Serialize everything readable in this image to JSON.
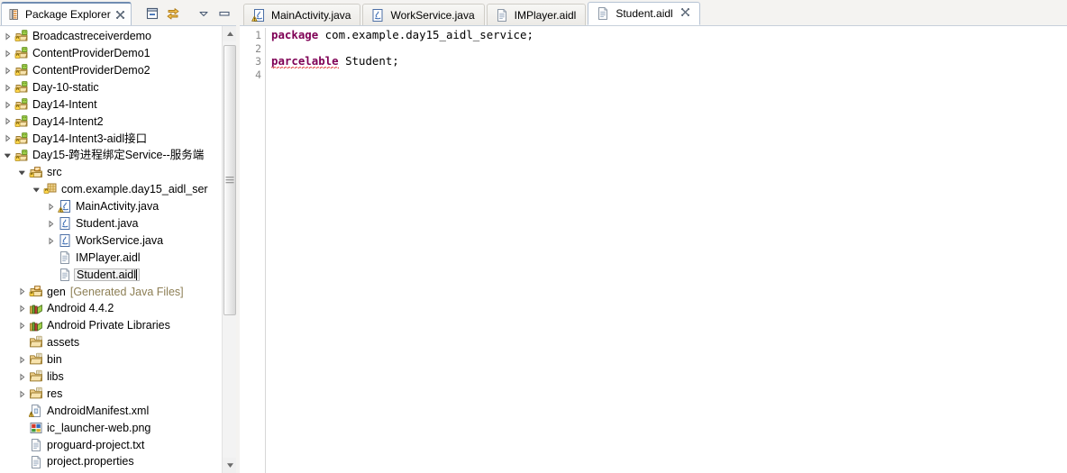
{
  "explorer": {
    "tab": {
      "title": "Package Explorer",
      "icon": "package-explorer-icon",
      "close_icon": "close-icon"
    },
    "toolbar": [
      {
        "name": "collapse-all-button",
        "icon": "collapse-all-icon"
      },
      {
        "name": "link-with-editor-button",
        "icon": "link-with-editor-icon"
      },
      {
        "name": "view-menu-button",
        "icon": "chevron-down-icon"
      },
      {
        "name": "minimize-button",
        "icon": "minimize-icon"
      },
      {
        "name": "maximize-button",
        "icon": "maximize-icon"
      }
    ],
    "tree": [
      {
        "label": "Broadcastreceiverdemo",
        "indent": 0,
        "arrow": "collapsed",
        "icon": "android-project-icon"
      },
      {
        "label": "ContentProviderDemo1",
        "indent": 0,
        "arrow": "collapsed",
        "icon": "android-project-icon"
      },
      {
        "label": "ContentProviderDemo2",
        "indent": 0,
        "arrow": "collapsed",
        "icon": "android-project-icon"
      },
      {
        "label": "Day-10-static",
        "indent": 0,
        "arrow": "collapsed",
        "icon": "android-project-icon"
      },
      {
        "label": "Day14-Intent",
        "indent": 0,
        "arrow": "collapsed",
        "icon": "android-project-icon"
      },
      {
        "label": "Day14-Intent2",
        "indent": 0,
        "arrow": "collapsed",
        "icon": "android-project-icon"
      },
      {
        "label": "Day14-Intent3-aidl接口",
        "indent": 0,
        "arrow": "collapsed",
        "icon": "android-project-icon"
      },
      {
        "label": "Day15-跨进程绑定Service--服务端",
        "indent": 0,
        "arrow": "expanded",
        "icon": "android-project-icon"
      },
      {
        "label": "src",
        "indent": 1,
        "arrow": "expanded",
        "icon": "source-folder-icon"
      },
      {
        "label": "com.example.day15_aidl_ser",
        "indent": 2,
        "arrow": "expanded",
        "icon": "package-icon"
      },
      {
        "label": "MainActivity.java",
        "indent": 3,
        "arrow": "collapsed",
        "icon": "java-warning-icon"
      },
      {
        "label": "Student.java",
        "indent": 3,
        "arrow": "collapsed",
        "icon": "java-icon"
      },
      {
        "label": "WorkService.java",
        "indent": 3,
        "arrow": "collapsed",
        "icon": "java-icon"
      },
      {
        "label": "IMPlayer.aidl",
        "indent": 3,
        "arrow": "none",
        "icon": "file-icon"
      },
      {
        "label": "Student.aidl",
        "indent": 3,
        "arrow": "none",
        "icon": "file-icon",
        "selected": true
      },
      {
        "label": "gen",
        "suffix": "[Generated Java Files]",
        "indent": 1,
        "arrow": "collapsed",
        "icon": "source-folder-icon"
      },
      {
        "label": "Android 4.4.2",
        "indent": 1,
        "arrow": "collapsed",
        "icon": "library-icon"
      },
      {
        "label": "Android Private Libraries",
        "indent": 1,
        "arrow": "collapsed",
        "icon": "library-icon"
      },
      {
        "label": "assets",
        "indent": 1,
        "arrow": "none",
        "icon": "folder-icon"
      },
      {
        "label": "bin",
        "indent": 1,
        "arrow": "collapsed",
        "icon": "folder-icon"
      },
      {
        "label": "libs",
        "indent": 1,
        "arrow": "collapsed",
        "icon": "folder-icon"
      },
      {
        "label": "res",
        "indent": 1,
        "arrow": "collapsed",
        "icon": "folder-icon"
      },
      {
        "label": "AndroidManifest.xml",
        "indent": 1,
        "arrow": "none",
        "icon": "manifest-icon"
      },
      {
        "label": "ic_launcher-web.png",
        "indent": 1,
        "arrow": "none",
        "icon": "image-icon"
      },
      {
        "label": "proguard-project.txt",
        "indent": 1,
        "arrow": "none",
        "icon": "file-icon"
      },
      {
        "label": "project.properties",
        "indent": 1,
        "arrow": "none",
        "icon": "file-icon"
      }
    ]
  },
  "editor": {
    "tabs": [
      {
        "label": "MainActivity.java",
        "icon": "java-warning-icon",
        "active": false,
        "closable": false
      },
      {
        "label": "WorkService.java",
        "icon": "java-icon",
        "active": false,
        "closable": false
      },
      {
        "label": "IMPlayer.aidl",
        "icon": "file-icon",
        "active": false,
        "closable": false
      },
      {
        "label": "Student.aidl",
        "icon": "file-icon",
        "active": true,
        "closable": true,
        "close_icon": "close-icon"
      }
    ],
    "gutter": [
      "1",
      "2",
      "3",
      "4"
    ],
    "lines": [
      {
        "n": "1",
        "keyword": "package",
        "rest": " com.example.day15_aidl_service;"
      },
      {
        "n": "2",
        "keyword": "",
        "rest": ""
      },
      {
        "n": "3",
        "keyword": "parcelable",
        "rest": " Student;",
        "error": true
      },
      {
        "n": "4",
        "keyword": "",
        "rest": ""
      }
    ]
  },
  "colors": {
    "keyword": "#7f0055",
    "editor_bg": "#ffffff",
    "chrome_bg": "#f4f3f1",
    "active_tab_border": "#6f8cb1",
    "gutter_text": "#888888",
    "dim_text": "#8d7f55",
    "error_underline": "#e03030"
  }
}
